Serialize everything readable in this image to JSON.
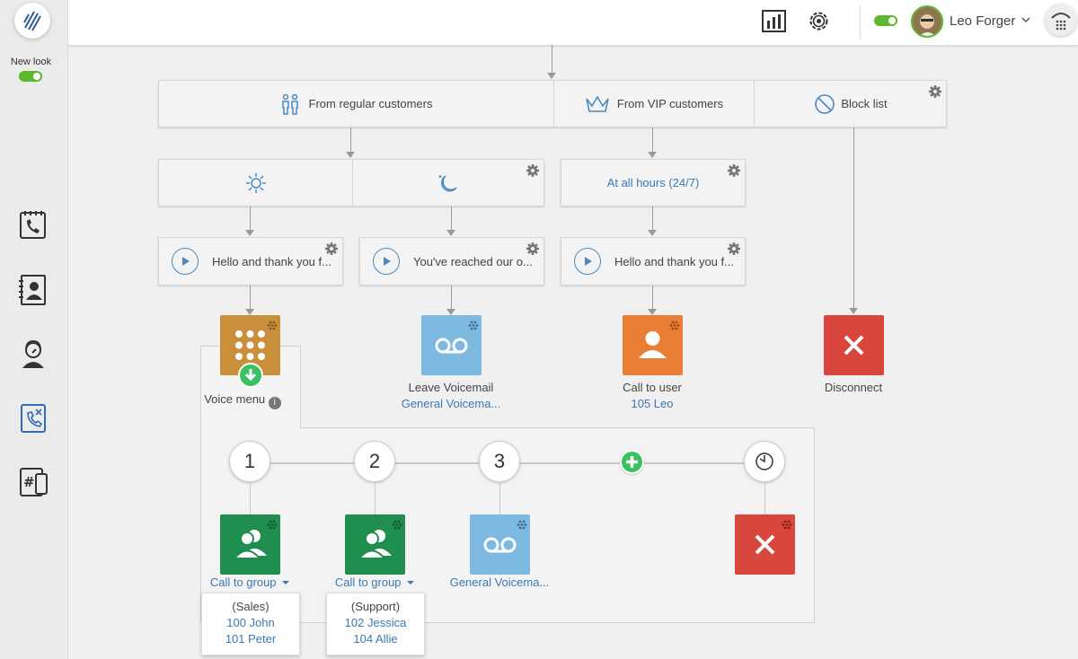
{
  "header": {
    "user_name": "Leo Forger",
    "icons": [
      "statistics-icon",
      "settings-icon",
      "availability-toggle",
      "avatar",
      "chevron-down-icon",
      "dialpad-icon"
    ]
  },
  "sidebar": {
    "new_look_label": "New look",
    "items": [
      "call-history-icon",
      "contacts-icon",
      "agent-icon",
      "call-flow-icon",
      "numbers-icon"
    ]
  },
  "flow": {
    "routing": {
      "regular": "From regular customers",
      "vip": "From VIP customers",
      "block": "Block list"
    },
    "schedule": {
      "all_hours": "At all hours (24/7)"
    },
    "greetings": {
      "g1": "Hello and thank you f...",
      "g2": "You've reached our o...",
      "g3": "Hello and thank you f..."
    },
    "actions": {
      "voice_menu": "Voice menu",
      "leave_voicemail": "Leave Voicemail",
      "leave_voicemail_target": "General Voicema...",
      "call_user": "Call to user",
      "call_user_target": "105 Leo",
      "disconnect": "Disconnect"
    },
    "menu": {
      "options": [
        "1",
        "2",
        "3"
      ],
      "group_label": "Call to group",
      "voicemail_target": "General Voicema...",
      "sales": {
        "name": "(Sales)",
        "members": [
          "100 John",
          "101 Peter"
        ]
      },
      "support": {
        "name": "(Support)",
        "members": [
          "102 Jessica",
          "104 Allie"
        ]
      }
    }
  },
  "colors": {
    "voice_menu": "#c98f3a",
    "voicemail": "#7db9e0",
    "user": "#ea7e35",
    "disconnect": "#d9463e",
    "group": "#1f8e4f",
    "green": "#3cc161",
    "link": "#3a78b5"
  }
}
